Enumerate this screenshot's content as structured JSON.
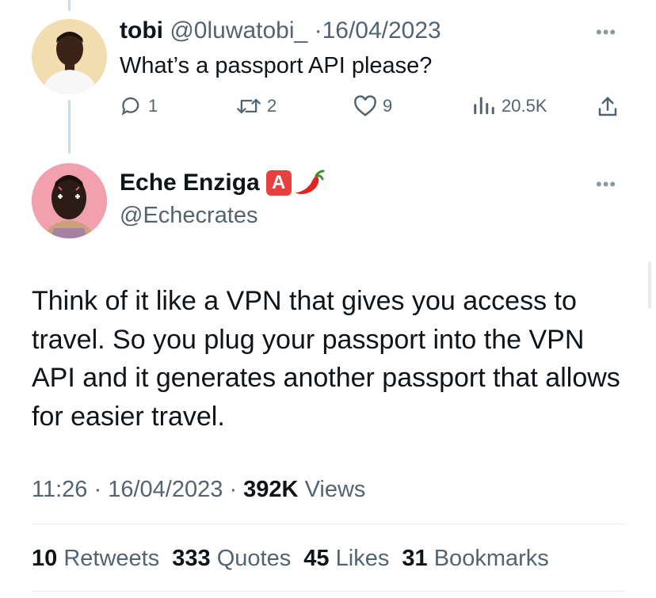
{
  "reply_to": {
    "name": "tobi",
    "handle": "@0luwatobi_",
    "separator": "·",
    "date": "16/04/2023",
    "text": "What’s a passport API please?",
    "replies": "1",
    "retweets": "2",
    "likes": "9",
    "views": "20.5K"
  },
  "main_tweet": {
    "name": "Eche Enziga",
    "badge_letter": "A",
    "chili_emoji": "🌶",
    "handle": "@Echecrates",
    "text": "Think of it like a VPN that gives you access to travel. So you plug your passport into the VPN API and it generates another passport that allows for easier travel.",
    "time": "11:26",
    "separator": "·",
    "date": "16/04/2023",
    "views_count": "392K",
    "views_label": "Views"
  },
  "stats": [
    {
      "count": "10",
      "label": "Retweets"
    },
    {
      "count": "333",
      "label": "Quotes"
    },
    {
      "count": "45",
      "label": "Likes"
    },
    {
      "count": "31",
      "label": "Bookmarks"
    }
  ],
  "icons": {
    "reply": "reply-icon",
    "retweet": "retweet-icon",
    "like": "heart-icon",
    "views": "analytics-icon",
    "share": "share-icon",
    "more": "more-icon"
  },
  "colors": {
    "text": "#0f1419",
    "secondary": "#536471",
    "divider": "#eff3f4",
    "badge": "#e7413f"
  }
}
